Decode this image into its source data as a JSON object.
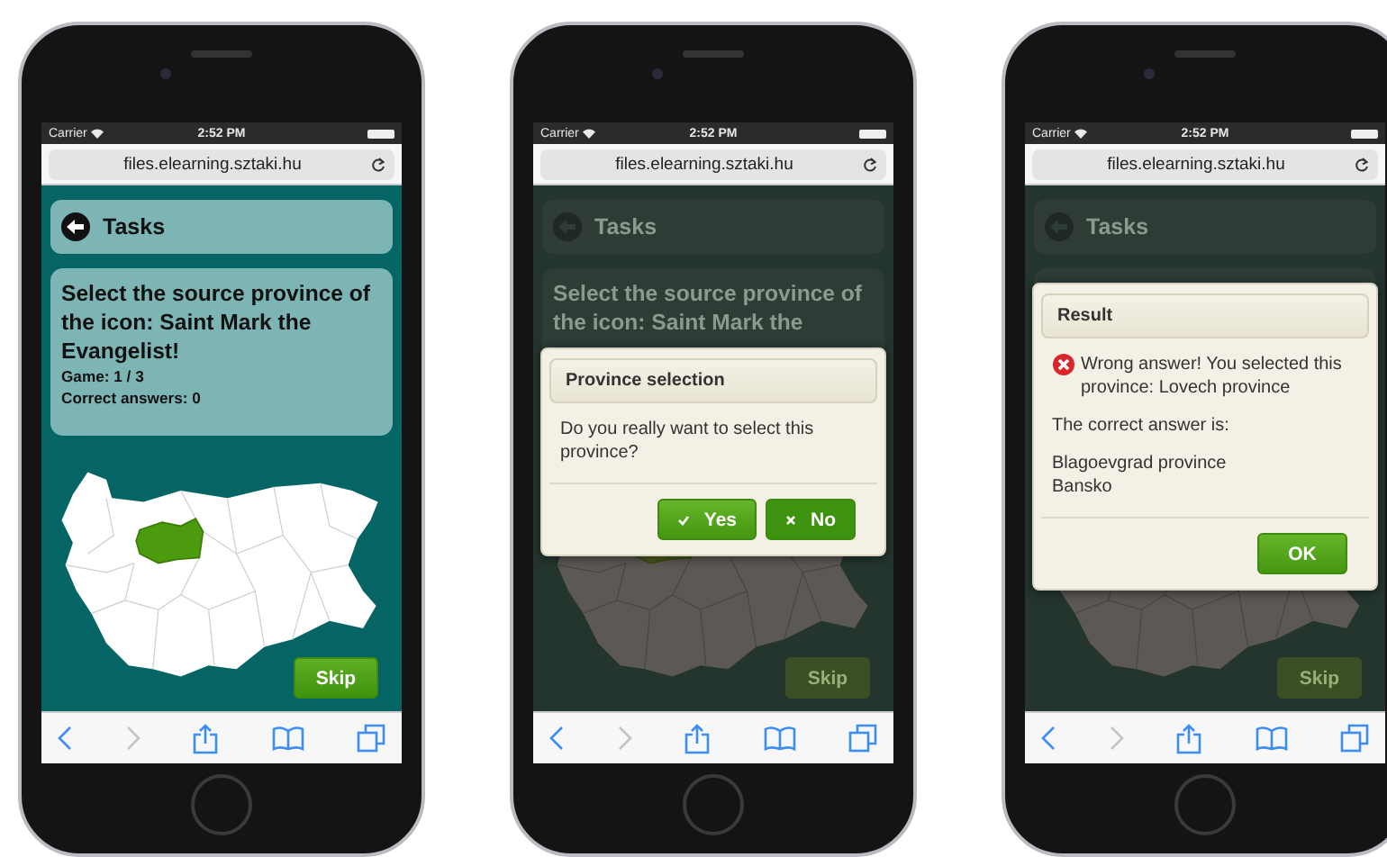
{
  "phones": [
    {
      "status_bar": {
        "carrier": "Carrier",
        "time": "2:52 PM"
      },
      "url": "files.elearning.sztaki.hu",
      "dimmed": false,
      "header": {
        "title": "Tasks"
      },
      "question": {
        "text": "Select the source province of the icon: Saint Mark the Evangelist!",
        "game": "Game: 1 / 3",
        "score": "Correct answers: 0"
      },
      "map": {
        "highlighted": true
      },
      "skip": "Skip",
      "toolbar": [
        {
          "kind": "back",
          "disabled": false
        },
        {
          "kind": "forward",
          "disabled": true
        },
        {
          "kind": "share",
          "disabled": false
        },
        {
          "kind": "bookmarks",
          "disabled": false
        },
        {
          "kind": "tabs",
          "disabled": false
        }
      ]
    },
    {
      "status_bar": {
        "carrier": "Carrier",
        "time": "2:52 PM"
      },
      "url": "files.elearning.sztaki.hu",
      "dimmed": true,
      "header": {
        "title": "Tasks"
      },
      "question": {
        "text": "Select the source province of the icon: Saint Mark the"
      },
      "map": {
        "highlighted": true
      },
      "skip": "Skip",
      "dialog": {
        "kind": "confirm",
        "title": "Province selection",
        "paragraphs": [
          {
            "lines": [
              "Do you really want to select this province?"
            ]
          }
        ],
        "buttons": [
          {
            "label": "Yes",
            "kind": "confirm"
          },
          {
            "label": "No",
            "kind": "cancel"
          }
        ]
      },
      "toolbar": [
        {
          "kind": "back",
          "disabled": false
        },
        {
          "kind": "forward",
          "disabled": true
        },
        {
          "kind": "share",
          "disabled": false
        },
        {
          "kind": "bookmarks",
          "disabled": false
        },
        {
          "kind": "tabs",
          "disabled": false
        }
      ]
    },
    {
      "status_bar": {
        "carrier": "Carrier",
        "time": "2:52 PM"
      },
      "url": "files.elearning.sztaki.hu",
      "dimmed": true,
      "header": {
        "title": "Tasks"
      },
      "skip": "Skip",
      "dialog": {
        "kind": "result",
        "title": "Result",
        "paragraphs": [
          {
            "kind": "error",
            "lines": [
              "Wrong answer! You selected this province: Lovech province"
            ]
          },
          {
            "lines": [
              "The correct answer is:"
            ]
          },
          {
            "lines": [
              "Blagoevgrad province",
              "Bansko"
            ]
          }
        ],
        "buttons": [
          {
            "label": "OK"
          }
        ]
      },
      "toolbar": [
        {
          "kind": "back",
          "disabled": false
        },
        {
          "kind": "forward",
          "disabled": true
        },
        {
          "kind": "share",
          "disabled": false
        },
        {
          "kind": "bookmarks",
          "disabled": false
        },
        {
          "kind": "tabs",
          "disabled": false
        }
      ]
    }
  ]
}
